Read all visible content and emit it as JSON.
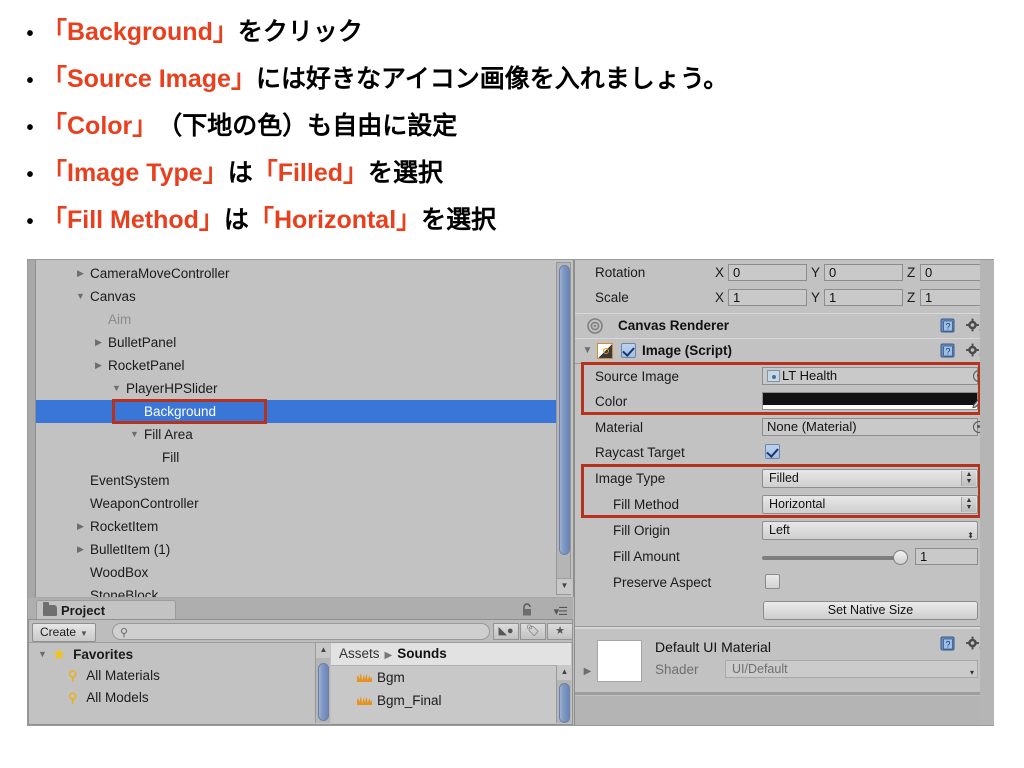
{
  "slide": {
    "bullets": [
      {
        "segments": [
          {
            "text": "「Background」",
            "color": "red"
          },
          {
            "text": " をクリック",
            "color": "black"
          }
        ]
      },
      {
        "segments": [
          {
            "text": "「Source Image」",
            "color": "red"
          },
          {
            "text": " には好きなアイコン画像を入れましょう。",
            "color": "black"
          }
        ]
      },
      {
        "segments": [
          {
            "text": "「Color」",
            "color": "red"
          },
          {
            "text": "（下地の色）も自由に設定",
            "color": "black"
          }
        ]
      },
      {
        "segments": [
          {
            "text": "「Image Type」",
            "color": "red"
          },
          {
            "text": " は ",
            "color": "black"
          },
          {
            "text": "「Filled」",
            "color": "red"
          },
          {
            "text": " を選択",
            "color": "black"
          }
        ]
      },
      {
        "segments": [
          {
            "text": "「Fill Method」",
            "color": "red"
          },
          {
            "text": " は ",
            "color": "black"
          },
          {
            "text": "「Horizontal」",
            "color": "red"
          },
          {
            "text": " を選択",
            "color": "black"
          }
        ]
      }
    ],
    "bullet_marker": "•",
    "accent_color": "#e8401f",
    "text_color": "#000000",
    "highlight_box_color": "#b5321c"
  },
  "hierarchy": {
    "rows": [
      {
        "label": "CameraMoveController",
        "indent": 1,
        "arrow": "collapsed",
        "selected": false,
        "dim": false
      },
      {
        "label": "Canvas",
        "indent": 1,
        "arrow": "expanded",
        "selected": false,
        "dim": false
      },
      {
        "label": "Aim",
        "indent": 2,
        "arrow": "none",
        "selected": false,
        "dim": true
      },
      {
        "label": "BulletPanel",
        "indent": 2,
        "arrow": "collapsed",
        "selected": false,
        "dim": false
      },
      {
        "label": "RocketPanel",
        "indent": 2,
        "arrow": "collapsed",
        "selected": false,
        "dim": false
      },
      {
        "label": "PlayerHPSlider",
        "indent": 2,
        "arrow": "expanded",
        "selected": false,
        "dim": false
      },
      {
        "label": "Background",
        "indent": 3,
        "arrow": "none",
        "selected": true,
        "dim": false
      },
      {
        "label": "Fill Area",
        "indent": 3,
        "arrow": "expanded",
        "selected": false,
        "dim": false
      },
      {
        "label": "Fill",
        "indent": 4,
        "arrow": "none",
        "selected": false,
        "dim": false
      },
      {
        "label": "EventSystem",
        "indent": 1,
        "arrow": "none",
        "selected": false,
        "dim": false
      },
      {
        "label": "WeaponController",
        "indent": 1,
        "arrow": "none",
        "selected": false,
        "dim": false
      },
      {
        "label": "RocketItem",
        "indent": 1,
        "arrow": "collapsed",
        "selected": false,
        "dim": false
      },
      {
        "label": "BulletItem (1)",
        "indent": 1,
        "arrow": "collapsed",
        "selected": false,
        "dim": false
      },
      {
        "label": "WoodBox",
        "indent": 1,
        "arrow": "none",
        "selected": false,
        "dim": false
      },
      {
        "label": "StoneBlock",
        "indent": 1,
        "arrow": "none",
        "selected": false,
        "dim": false
      }
    ],
    "scroll_down_glyph": "▼"
  },
  "project": {
    "tab_label": "Project",
    "create_label": "Create",
    "create_caret": "▼",
    "search_placeholder": "",
    "search_value": "",
    "search_icon": "search-icon",
    "lock_icon": "lock-icon",
    "menu_icon": "hamburger-menu-icon",
    "toolbar_icons": [
      "object-filter-icon",
      "label-filter-icon",
      "favorite-filter-icon"
    ],
    "tree": [
      {
        "label": "Favorites",
        "icon": "star-icon",
        "indent": 0,
        "arrow": "expanded",
        "bold": true
      },
      {
        "label": "All Materials",
        "icon": "search-icon",
        "indent": 1,
        "arrow": "none",
        "bold": false
      },
      {
        "label": "All Models",
        "icon": "search-icon",
        "indent": 1,
        "arrow": "none",
        "bold": false
      }
    ],
    "breadcrumb": {
      "root": "Assets",
      "arrow": "▶",
      "current": "Sounds"
    },
    "assets": [
      {
        "label": "Bgm",
        "icon": "audio-clip-icon"
      },
      {
        "label": "Bgm_Final",
        "icon": "audio-clip-icon"
      }
    ]
  },
  "inspector": {
    "transform_rows": [
      {
        "label": "Rotation",
        "x": "0",
        "y": "0",
        "z": "0"
      },
      {
        "label": "Scale",
        "x": "1",
        "y": "1",
        "z": "1"
      }
    ],
    "axis_labels": {
      "x": "X",
      "y": "Y",
      "z": "Z"
    },
    "canvas_renderer": {
      "title": "Canvas Renderer",
      "icon": "canvas-renderer-icon"
    },
    "image_script": {
      "title": "Image (Script)",
      "enabled": true,
      "foldout": "expanded",
      "icon": "image-script-icon",
      "fields": {
        "source_image_label": "Source Image",
        "source_image_value": "LT Health",
        "color_label": "Color",
        "color_value": "#000000",
        "color_alpha_bar": "#ffffff",
        "material_label": "Material",
        "material_value": "None (Material)",
        "raycast_label": "Raycast Target",
        "raycast_checked": true,
        "image_type_label": "Image Type",
        "image_type_value": "Filled",
        "fill_method_label": "Fill Method",
        "fill_method_value": "Horizontal",
        "fill_origin_label": "Fill Origin",
        "fill_origin_value": "Left",
        "fill_amount_label": "Fill Amount",
        "fill_amount_value": "1",
        "preserve_aspect_label": "Preserve Aspect",
        "preserve_aspect_checked": false,
        "set_native_size_label": "Set Native Size"
      }
    },
    "material": {
      "title": "Default UI Material",
      "shader_label": "Shader",
      "shader_value": "UI/Default",
      "foldout": "collapsed"
    },
    "help_icon": "help-icon",
    "gear_icon": "gear-icon",
    "picker_icon": "eyedropper-icon",
    "target_icon": "object-picker-icon"
  }
}
